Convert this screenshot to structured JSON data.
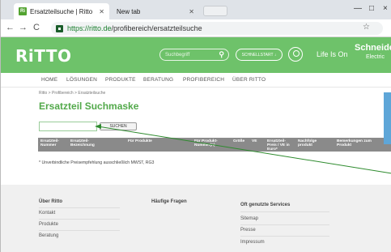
{
  "browser": {
    "tabs": [
      {
        "label": "Ersatzteilsuche | Ritto",
        "favicon": "Ri"
      },
      {
        "label": "New tab"
      }
    ],
    "url_host": "https://ritto.de",
    "url_path": "/profibereich/ersatzteilsuche",
    "window_controls": {
      "minimize": "—",
      "maximize": "□",
      "close": "×"
    }
  },
  "header": {
    "logo": "RiTTO",
    "search_placeholder": "Suchbegriff",
    "quick_button": "SCHNELLSTART ↓",
    "life_is_on": "Life Is On",
    "brand": "Schneider",
    "brand_sub": "Electric",
    "background": "#6ec26a"
  },
  "nav": {
    "items": [
      "HOME",
      "LÖSUNGEN",
      "PRODUKTE",
      "BERATUNG",
      "PROFIBEREICH",
      "ÜBER RITTO"
    ]
  },
  "breadcrumb": "Ritto >  Profibereich >  Ersatzteilsuche",
  "page": {
    "title": "Ersatzteil Suchmaske",
    "search_value": "",
    "search_button": "SUCHEN",
    "columns": [
      "Ersatzteil-Nummer",
      "Ersatzteil-Bezeichnung",
      "Für Produkte",
      "Für Produkt-Nummer(n)",
      "Größe",
      "VE",
      "Ersatzteil-Preis / VE in Euro*",
      "Nachfolge produkt",
      "Bemerkungen zum Produkt"
    ],
    "footnote": "* Unverbindliche Preisempfehlung ausschließlich MWST, RG3",
    "accent": "#52a94a"
  },
  "footer": {
    "col1_title": "Über Ritto",
    "col1_links": [
      "Kontakt",
      "Produkte",
      "Beratung"
    ],
    "col2_title": "Häufige Fragen",
    "col3_title": "Oft genutzte Services",
    "col3_links": [
      "Sitemap",
      "Presse",
      "Impressum"
    ]
  }
}
